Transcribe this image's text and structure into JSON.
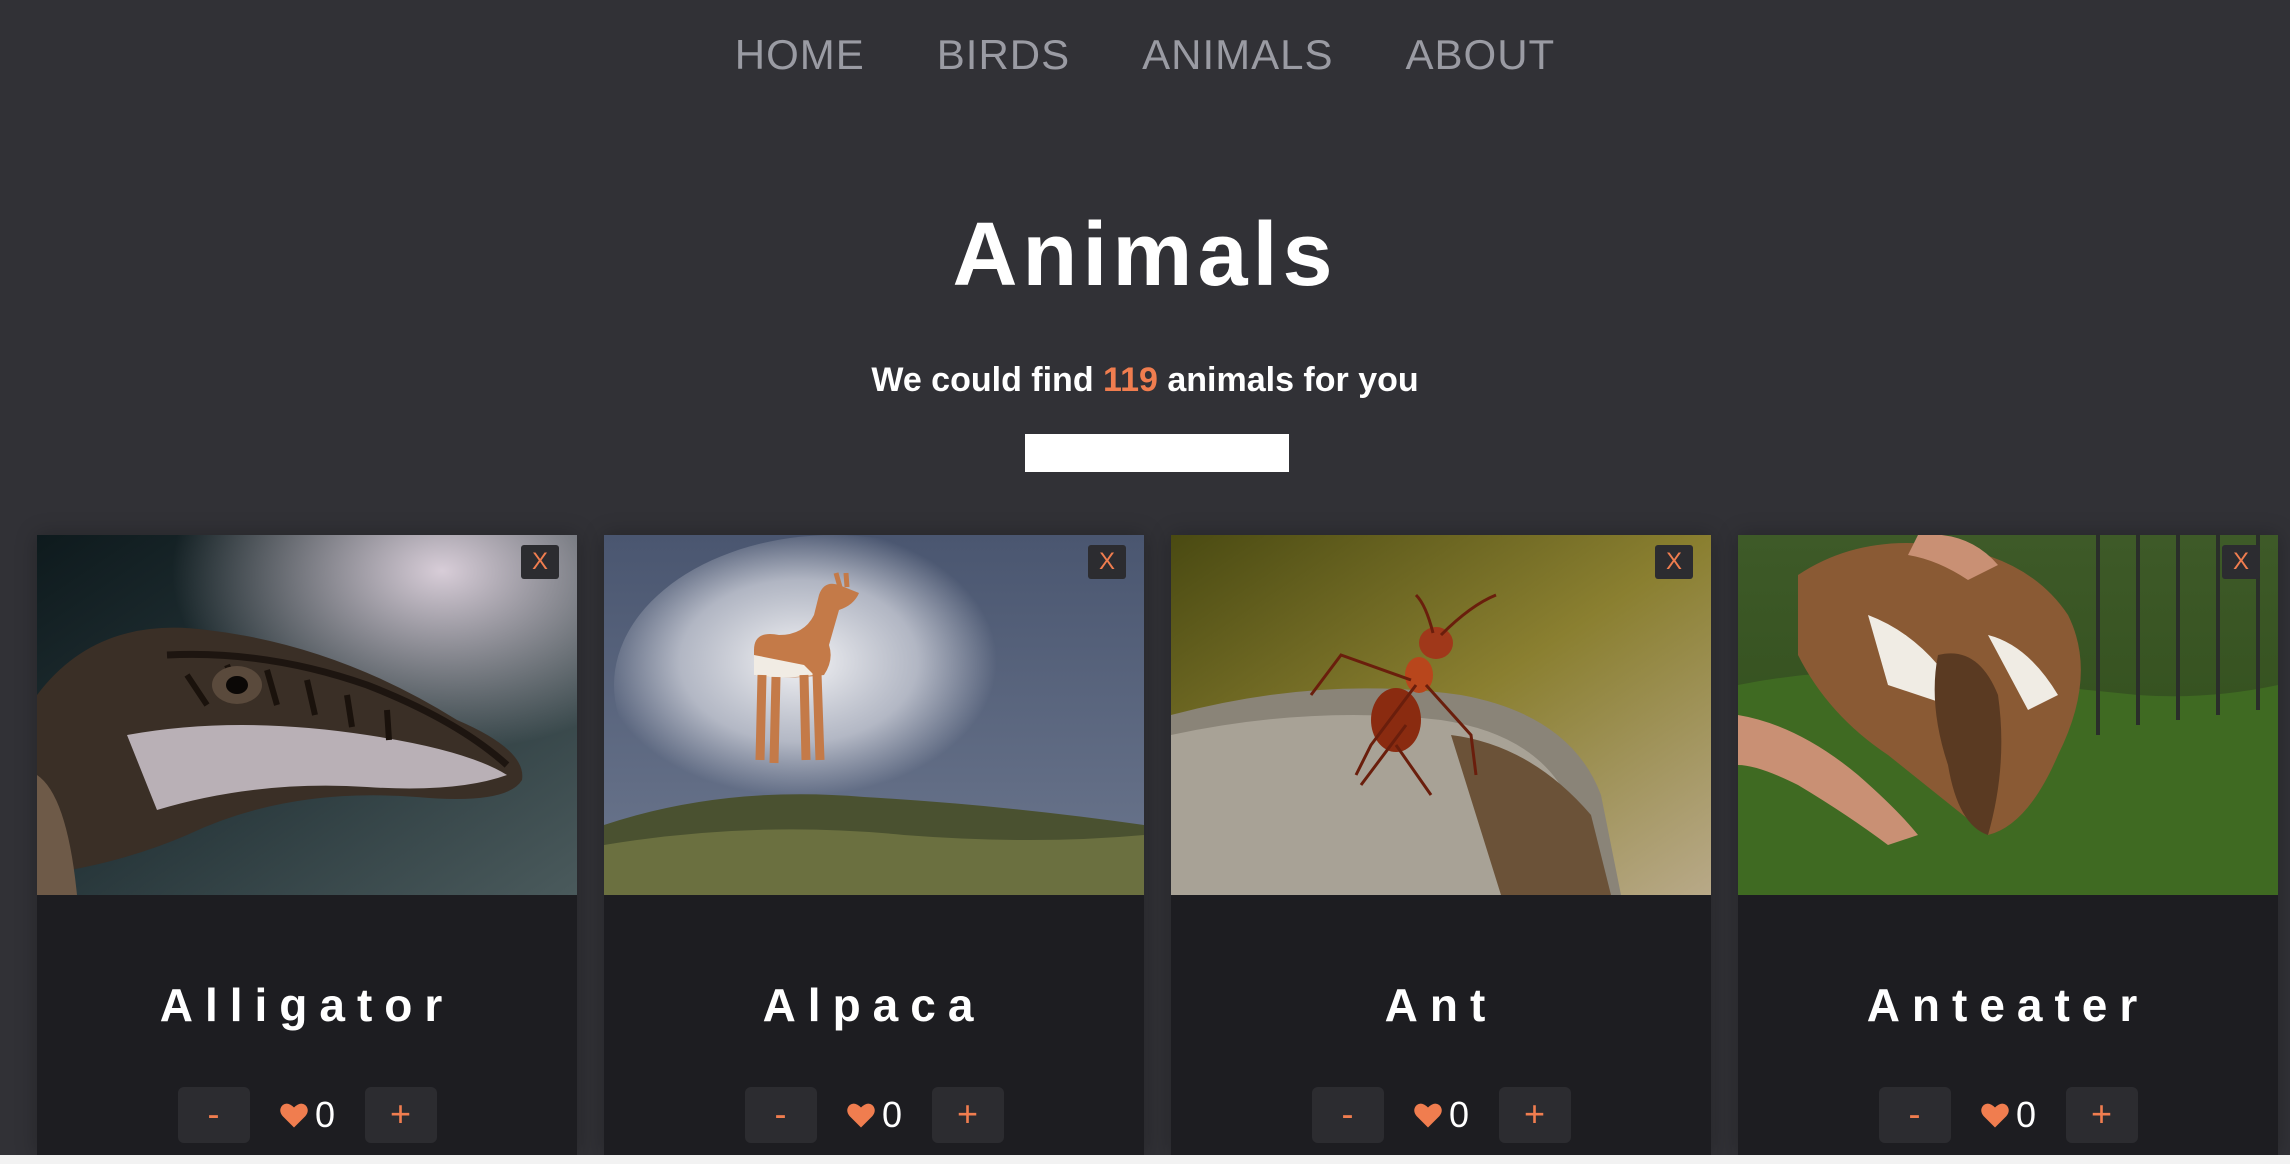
{
  "nav": {
    "items": [
      {
        "label": "HOME"
      },
      {
        "label": "BIRDS"
      },
      {
        "label": "ANIMALS"
      },
      {
        "label": "ABOUT"
      }
    ]
  },
  "page": {
    "title": "Animals",
    "subtitle_prefix": "We could find",
    "count": "119",
    "subtitle_suffix": "animals for you"
  },
  "search": {
    "value": "",
    "placeholder": ""
  },
  "cards": [
    {
      "name": "Alligator",
      "likes": "0",
      "close_label": "X",
      "minus_label": "-",
      "plus_label": "+",
      "photo": "alligator photo"
    },
    {
      "name": "Alpaca",
      "likes": "0",
      "close_label": "X",
      "minus_label": "-",
      "plus_label": "+",
      "photo": "alpaca photo"
    },
    {
      "name": "Ant",
      "likes": "0",
      "close_label": "X",
      "minus_label": "-",
      "plus_label": "+",
      "photo": "ant photo"
    },
    {
      "name": "Anteater",
      "likes": "0",
      "close_label": "X",
      "minus_label": "-",
      "plus_label": "+",
      "photo": "anteater photo"
    }
  ],
  "colors": {
    "background": "#313136",
    "card": "#1d1d21",
    "accent": "#f07d4f",
    "button": "#2c2c30",
    "nav_text": "#9a9ba3"
  },
  "icons": {
    "heart": "heart-icon",
    "close": "close-icon"
  }
}
